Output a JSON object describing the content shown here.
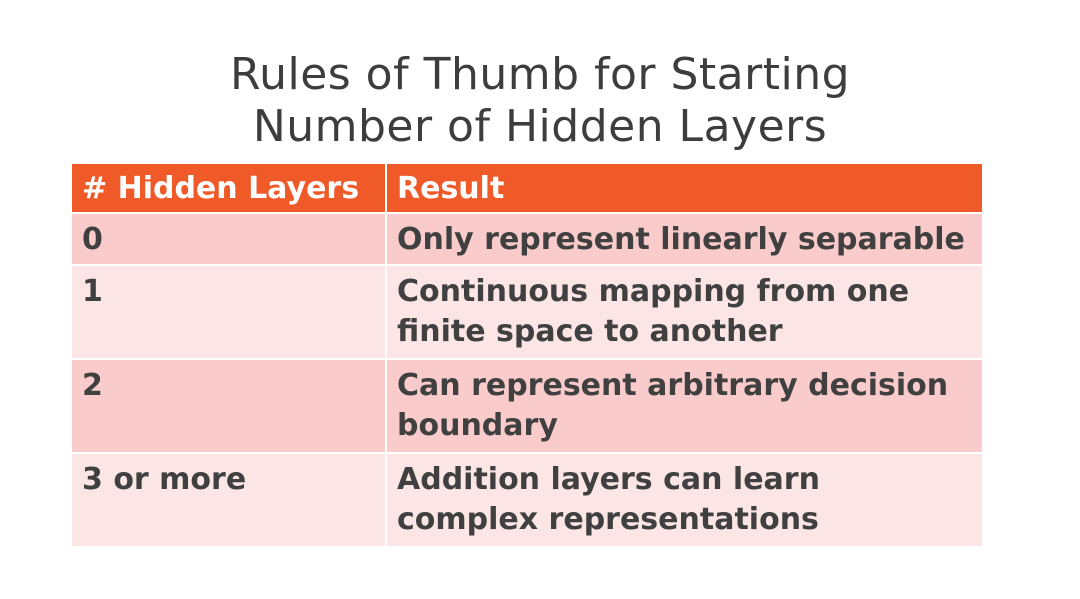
{
  "slide": {
    "title_lines": [
      "Rules of Thumb for Starting",
      "Number of Hidden Layers"
    ]
  },
  "table": {
    "headers": [
      "# Hidden Layers",
      "Result"
    ],
    "rows": [
      {
        "layers": "0",
        "result_lines": [
          "Only represent linearly separable"
        ]
      },
      {
        "layers": "1",
        "result_lines": [
          "Continuous mapping from one",
          "finite space to another"
        ]
      },
      {
        "layers": "2",
        "result_lines": [
          "Can represent arbitrary decision",
          "boundary"
        ]
      },
      {
        "layers": "3 or more",
        "result_lines": [
          "Addition layers can learn",
          "complex representations"
        ]
      }
    ]
  },
  "colors": {
    "header_bg": "#f05a28",
    "row_dark": "#f9cccb",
    "row_light": "#fce6e5",
    "text": "#404040"
  }
}
